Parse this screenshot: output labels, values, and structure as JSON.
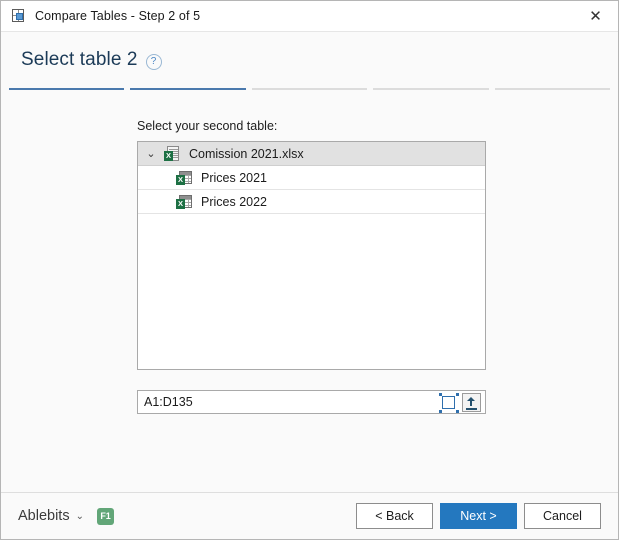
{
  "window": {
    "title": "Compare Tables - Step 2 of 5",
    "icon": "compare-tables-icon",
    "close_label": "✕"
  },
  "header": {
    "heading": "Select table 2",
    "help_icon": "?"
  },
  "steps": {
    "total": 5,
    "completed": 2,
    "segments": [
      "done",
      "done",
      "todo",
      "todo",
      "todo"
    ]
  },
  "main": {
    "field_label": "Select your second table:",
    "tree": [
      {
        "label": "Comission 2021.xlsx",
        "type": "workbook",
        "icon": "excel-workbook-icon",
        "expanded": true,
        "chevron": "⌄",
        "x_glyph": "X"
      },
      {
        "label": "Prices 2021",
        "type": "worksheet",
        "icon": "excel-sheet-icon",
        "x_glyph": "X"
      },
      {
        "label": "Prices 2022",
        "type": "worksheet",
        "icon": "excel-sheet-icon",
        "x_glyph": "X"
      }
    ],
    "range": {
      "value": "A1:D135",
      "placeholder": "",
      "select_range_icon": "select-range-icon",
      "collapse_icon": "collapse-dialog-icon"
    }
  },
  "footer": {
    "brand": "Ablebits",
    "brand_caret": "⌄",
    "help_badge": "F1",
    "back_label": "< Back",
    "next_label": "Next >",
    "cancel_label": "Cancel"
  },
  "colors": {
    "accent": "#2478bf",
    "step_done": "#4a79ad",
    "step_todo": "#dcdcdc",
    "heading": "#1b3a57",
    "badge_green": "#62a678",
    "excel_green": "#1d7044"
  }
}
